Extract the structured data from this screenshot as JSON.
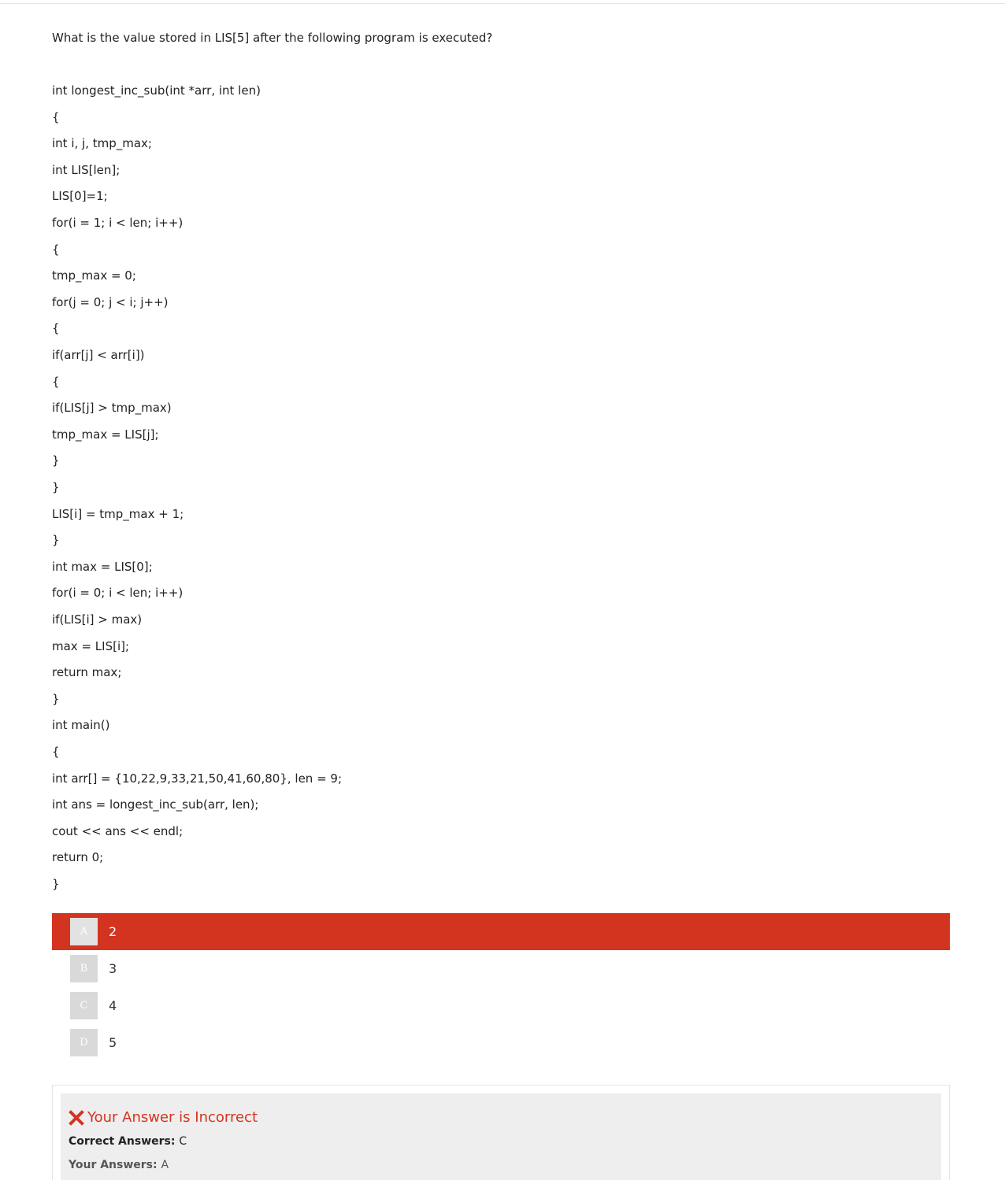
{
  "question": {
    "text": "What is the value stored in LIS[5] after the following program is executed?"
  },
  "code": [
    "int longest_inc_sub(int *arr, int len)",
    "{",
    "int i, j, tmp_max;",
    "int LIS[len];",
    "LIS[0]=1;",
    "for(i = 1; i < len; i++)",
    "{",
    "tmp_max = 0;",
    "for(j = 0; j < i; j++)",
    "{",
    "if(arr[j] < arr[i])",
    "{",
    "if(LIS[j] > tmp_max)",
    "tmp_max = LIS[j];",
    "}",
    "}",
    "LIS[i] = tmp_max + 1;",
    "}",
    "int max = LIS[0];",
    "for(i = 0; i < len; i++)",
    "if(LIS[i] > max)",
    "max = LIS[i];",
    "return max;",
    "}",
    "int main()",
    "{",
    "int arr[] = {10,22,9,33,21,50,41,60,80}, len = 9;",
    "int ans = longest_inc_sub(arr, len);",
    "cout << ans << endl;",
    "return 0;",
    "}"
  ],
  "options": [
    {
      "letter": "A",
      "text": "2",
      "state": "selected-wrong"
    },
    {
      "letter": "B",
      "text": "3",
      "state": "normal"
    },
    {
      "letter": "C",
      "text": "4",
      "state": "normal"
    },
    {
      "letter": "D",
      "text": "5",
      "state": "normal"
    }
  ],
  "feedback": {
    "icon": "x-icon",
    "title": "Your Answer is Incorrect",
    "correct_label": "Correct Answers:",
    "correct_value": "C",
    "yours_label": "Your Answers:",
    "yours_value": "A",
    "accent_color": "#d33420"
  }
}
